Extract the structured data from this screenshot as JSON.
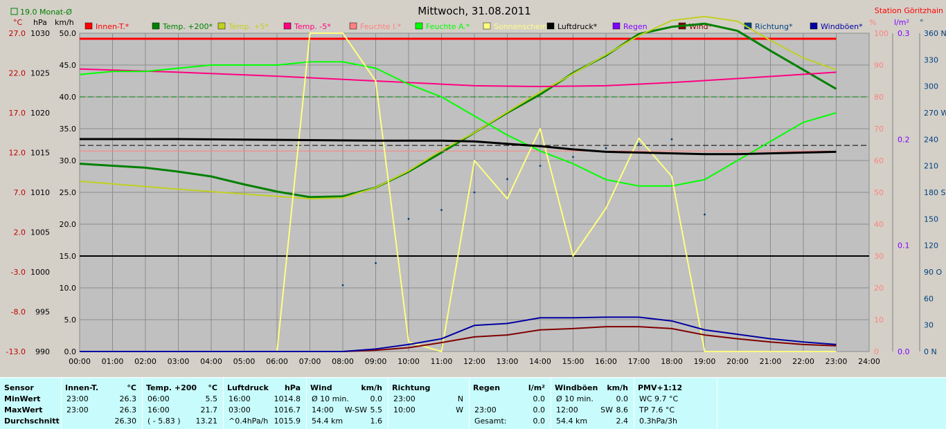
{
  "title": "Mittwoch, 31.08.2011",
  "station": "Station Göritzhain",
  "monthly_avg_label": "19.0 Monat-Ø",
  "legend": [
    {
      "label": "Innen-T.*",
      "color": "#ff0000"
    },
    {
      "label": "Temp. +200*",
      "color": "#008000"
    },
    {
      "label": "Temp. +5*",
      "color": "#c0d020"
    },
    {
      "label": "Temp. -5*",
      "color": "#ff0080"
    },
    {
      "label": "Feuchte I.*",
      "color": "#ff8080"
    },
    {
      "label": "Feuchte A.*",
      "color": "#00ff00"
    },
    {
      "label": "Sonnenschein",
      "color": "#ffff80"
    },
    {
      "label": "Luftdruck*",
      "color": "#000000"
    },
    {
      "label": "Regen",
      "color": "#8000ff"
    },
    {
      "label": "Wind*",
      "color": "#800000"
    },
    {
      "label": "Richtung*",
      "color": "#004080"
    },
    {
      "label": "Windböen*",
      "color": "#0000a0"
    }
  ],
  "axis_units": {
    "temp": "°C",
    "pressure": "hPa",
    "wind": "km/h",
    "humidity": "%",
    "rain": "l/m²",
    "direction": "°"
  },
  "chart_data": {
    "type": "line",
    "x_ticks": [
      "00:00",
      "01:00",
      "02:00",
      "03:00",
      "04:00",
      "05:00",
      "06:00",
      "07:00",
      "08:00",
      "09:00",
      "10:00",
      "11:00",
      "12:00",
      "13:00",
      "14:00",
      "15:00",
      "16:00",
      "17:00",
      "18:00",
      "19:00",
      "20:00",
      "21:00",
      "22:00",
      "23:00",
      "24:00"
    ],
    "xlim": [
      0,
      24
    ],
    "axes": {
      "temp": {
        "ticks": [
          "27.0",
          "22.0",
          "17.0",
          "12.0",
          "7.0",
          "2.0",
          "-3.0",
          "-8.0",
          "-13.0"
        ],
        "lim": [
          -13,
          27
        ]
      },
      "pressure": {
        "ticks": [
          "1030",
          "1025",
          "1020",
          "1015",
          "1010",
          "1005",
          "1000",
          "995",
          "990"
        ],
        "lim": [
          990,
          1030
        ]
      },
      "wind": {
        "ticks": [
          "50.0",
          "45.0",
          "40.0",
          "35.0",
          "30.0",
          "25.0",
          "20.0",
          "15.0",
          "10.0",
          "5.0",
          "0.0"
        ],
        "lim": [
          0,
          50
        ]
      },
      "humidity": {
        "ticks": [
          "100",
          "90",
          "80",
          "70",
          "60",
          "50",
          "40",
          "30",
          "20",
          "10",
          "0"
        ],
        "lim": [
          0,
          100
        ]
      },
      "rain": {
        "ticks": [
          "0.3",
          "0.2",
          "0.1",
          "0.0"
        ],
        "lim": [
          0,
          0.3
        ]
      },
      "direction": {
        "ticks": [
          "360 N",
          "330",
          "300",
          "270 W",
          "240",
          "210",
          "180 S",
          "150",
          "120",
          "90 O",
          "60",
          "30",
          "0 N"
        ],
        "lim": [
          0,
          360
        ]
      }
    },
    "reference_lines": [
      {
        "axis": "wind",
        "value": 15,
        "color": "#000000",
        "style": "solid"
      },
      {
        "axis": "temp",
        "value": 19.0,
        "color": "#008000",
        "style": "dashed"
      },
      {
        "axis": "pressure",
        "value": 1015.9,
        "color": "#000000",
        "style": "dashed"
      }
    ],
    "series": [
      {
        "name": "Innen-T.*",
        "axis": "temp",
        "color": "#ff0000",
        "width": 3,
        "x": [
          0,
          23
        ],
        "y": [
          26.3,
          26.3
        ]
      },
      {
        "name": "Temp. +200*",
        "axis": "temp",
        "color": "#008000",
        "width": 3,
        "x": [
          0,
          2,
          3,
          4,
          5,
          6,
          7,
          8,
          9,
          10,
          11,
          12,
          13,
          14,
          15,
          16,
          17,
          18,
          19,
          20,
          21,
          22,
          23
        ],
        "y": [
          10.6,
          10.1,
          9.6,
          9.0,
          8.0,
          7.1,
          6.4,
          6.5,
          7.6,
          9.6,
          12.0,
          14.5,
          17.0,
          19.3,
          22.0,
          24.2,
          26.9,
          27.8,
          28.2,
          27.3,
          24.8,
          22.4,
          20.0
        ]
      },
      {
        "name": "Temp. +5*",
        "axis": "temp",
        "color": "#c0d020",
        "width": 2,
        "x": [
          0,
          3,
          6,
          7,
          8,
          9,
          10,
          11,
          12,
          13,
          14,
          15,
          16,
          17,
          18,
          19,
          20,
          21,
          22,
          23
        ],
        "y": [
          8.4,
          7.4,
          6.5,
          6.2,
          6.3,
          7.6,
          9.7,
          12.3,
          14.5,
          17.1,
          19.6,
          21.9,
          24.3,
          26.7,
          28.6,
          29.1,
          28.5,
          26.1,
          23.9,
          22.4
        ]
      },
      {
        "name": "Temp. -5*",
        "axis": "temp",
        "color": "#ff0080",
        "width": 2,
        "x": [
          0,
          3,
          6,
          9,
          12,
          14,
          16,
          18,
          20,
          23
        ],
        "y": [
          22.5,
          22.1,
          21.6,
          21.0,
          20.4,
          20.3,
          20.4,
          20.8,
          21.3,
          22.1
        ]
      },
      {
        "name": "Feuchte I.*",
        "axis": "humidity",
        "color": "#ff8080",
        "width": 1,
        "x": [
          0,
          23
        ],
        "y": [
          63,
          63
        ]
      },
      {
        "name": "Feuchte A.*",
        "axis": "humidity",
        "color": "#00ff00",
        "width": 2,
        "x": [
          0,
          1,
          2,
          3,
          4,
          5,
          6,
          7,
          8,
          9,
          10,
          11,
          12,
          13,
          14,
          15,
          16,
          17,
          18,
          19,
          20,
          21,
          22,
          23
        ],
        "y": [
          87,
          88,
          88,
          89,
          90,
          90,
          90,
          91,
          91,
          89,
          84,
          80,
          74,
          68,
          63,
          59,
          54,
          52,
          52,
          54,
          60,
          66,
          72,
          75
        ]
      },
      {
        "name": "Sonnenschein",
        "axis": "humidity",
        "color": "#ffff80",
        "width": 2,
        "x": [
          0,
          5.999,
          6,
          7,
          8,
          9,
          10,
          11,
          12,
          13,
          14,
          15,
          16,
          17,
          18,
          19,
          23
        ],
        "y": [
          0,
          0,
          0,
          100,
          100,
          85,
          3,
          0,
          60,
          48,
          70,
          30,
          45,
          67,
          55,
          0,
          0
        ]
      },
      {
        "name": "Luftdruck*",
        "axis": "pressure",
        "color": "#000000",
        "width": 3,
        "x": [
          0,
          3,
          6,
          9,
          11,
          12,
          13,
          14,
          15,
          16,
          17,
          18,
          19,
          20,
          21,
          22,
          23
        ],
        "y": [
          1016.7,
          1016.7,
          1016.6,
          1016.5,
          1016.5,
          1016.4,
          1016.1,
          1015.8,
          1015.4,
          1015.1,
          1015.0,
          1014.9,
          1014.8,
          1014.8,
          1014.9,
          1015.0,
          1015.1
        ]
      },
      {
        "name": "Wind*",
        "axis": "wind",
        "color": "#800000",
        "width": 2,
        "x": [
          0,
          8,
          9,
          10,
          11,
          12,
          13,
          14,
          15,
          16,
          17,
          18,
          19,
          20,
          21,
          22,
          23
        ],
        "y": [
          0,
          0,
          0.2,
          0.6,
          1.4,
          2.3,
          2.6,
          3.4,
          3.6,
          3.9,
          3.9,
          3.6,
          2.6,
          2.0,
          1.5,
          1.1,
          0.9
        ]
      },
      {
        "name": "Windböen*",
        "axis": "wind",
        "color": "#0000a0",
        "width": 2,
        "x": [
          0,
          8,
          9,
          10,
          11,
          12,
          13,
          14,
          15,
          16,
          17,
          18,
          19,
          20,
          21,
          22,
          23
        ],
        "y": [
          0,
          0,
          0.4,
          1.1,
          2.0,
          4.1,
          4.4,
          5.3,
          5.3,
          5.4,
          5.4,
          4.8,
          3.4,
          2.7,
          2.0,
          1.5,
          1.1
        ]
      }
    ],
    "direction_points": {
      "axis": "direction",
      "color": "#004080",
      "x": [
        8,
        9,
        10,
        11,
        12,
        13,
        14,
        15,
        16,
        17,
        18,
        19
      ],
      "y": [
        75,
        100,
        150,
        160,
        180,
        195,
        210,
        220,
        230,
        235,
        240,
        155
      ]
    }
  },
  "stats": [
    {
      "title": "Sensor",
      "unit": "",
      "rows": [
        [
          "MinWert",
          "",
          ""
        ],
        [
          "MaxWert",
          "",
          ""
        ],
        [
          "Durchschnitt",
          "",
          ""
        ]
      ]
    },
    {
      "title": "Innen-T.",
      "unit": "°C",
      "rows": [
        [
          "23:00",
          "",
          "26.3"
        ],
        [
          "23:00",
          "",
          "26.3"
        ],
        [
          "",
          "",
          "26.30"
        ]
      ]
    },
    {
      "title": "Temp. +200",
      "unit": "°C",
      "rows": [
        [
          "06:00",
          "",
          "5.5"
        ],
        [
          "16:00",
          "",
          "21.7"
        ],
        [
          "( - 5.83 )",
          "",
          "13.21"
        ]
      ]
    },
    {
      "title": "Luftdruck",
      "unit": "hPa",
      "rows": [
        [
          "16:00",
          "",
          "1014.8"
        ],
        [
          "03:00",
          "",
          "1016.7"
        ],
        [
          "^0.4hPa/h",
          "",
          "1015.9"
        ]
      ]
    },
    {
      "title": "Wind",
      "unit": "km/h",
      "rows": [
        [
          "Ø 10 min.",
          "",
          "0.0"
        ],
        [
          "14:00",
          "W-SW",
          "5.5"
        ],
        [
          "54.4 km",
          "",
          "1.6"
        ]
      ]
    },
    {
      "title": "Richtung",
      "unit": "",
      "rows": [
        [
          "23:00",
          "",
          "N"
        ],
        [
          "10:00",
          "",
          "W"
        ],
        [
          "",
          "",
          ""
        ]
      ]
    },
    {
      "title": "Regen",
      "unit": "l/m²",
      "rows": [
        [
          "",
          "",
          "0.0"
        ],
        [
          "23:00",
          "",
          "0.0"
        ],
        [
          "Gesamt:",
          "",
          "0.0"
        ]
      ]
    },
    {
      "title": "Windböen",
      "unit": "km/h",
      "rows": [
        [
          "Ø 10 min.",
          "",
          "0.0"
        ],
        [
          "12:00",
          "SW",
          "8.6"
        ],
        [
          "54.4 km",
          "",
          "2.4"
        ]
      ]
    },
    {
      "title": "PMV+1:12",
      "unit": "",
      "rows": [
        [
          "WC 9.7 °C",
          "",
          ""
        ],
        [
          "TP 7.6 °C",
          "",
          ""
        ],
        [
          "0.3hPa/3h",
          "",
          ""
        ]
      ]
    }
  ]
}
